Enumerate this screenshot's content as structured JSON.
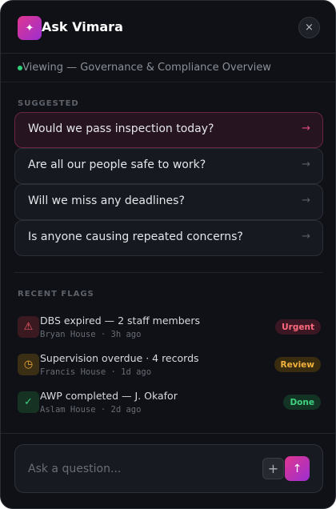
{
  "header": {
    "logo_glyph": "✦",
    "title": "Ask Vimara",
    "close_glyph": "×"
  },
  "context": {
    "label": "Viewing — Governance & Compliance Overview",
    "status_color": "#2fd07a"
  },
  "suggested": {
    "heading": "SUGGESTED",
    "arrow_glyph": "→",
    "items": [
      {
        "label": "Would we pass inspection today?"
      },
      {
        "label": "Are all our people safe to work?"
      },
      {
        "label": "Will we miss any deadlines?"
      },
      {
        "label": "Is anyone causing repeated concerns?"
      }
    ]
  },
  "flags": {
    "heading": "RECENT FLAGS",
    "items": [
      {
        "icon": "warning-icon",
        "glyph": "⚠",
        "title": "DBS expired — 2 staff members",
        "meta": "Bryan House · 3h ago",
        "badge": "Urgent",
        "status": "urgent"
      },
      {
        "icon": "clock-icon",
        "glyph": "◷",
        "title": "Supervision overdue · 4 records",
        "meta": "Francis House · 1d ago",
        "badge": "Review",
        "status": "review"
      },
      {
        "icon": "check-icon",
        "glyph": "✓",
        "title": "AWP completed — J. Okafor",
        "meta": "Aslam House · 2d ago",
        "badge": "Done",
        "status": "done"
      }
    ]
  },
  "composer": {
    "placeholder": "Ask a question...",
    "value": "",
    "attach_glyph": "+",
    "send_glyph": "↑"
  },
  "colors": {
    "accent_start": "#e0368f",
    "accent_end": "#9c2fd1",
    "urgent": "#ff6a7f",
    "review": "#f2b23e",
    "done": "#3fd27f"
  }
}
